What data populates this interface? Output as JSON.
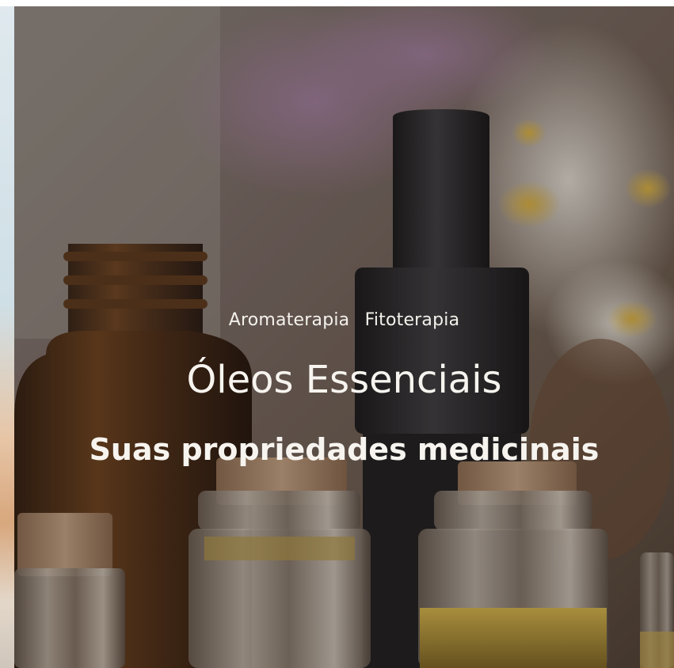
{
  "hero": {
    "tags": [
      "Aromaterapia",
      "Fitoterapia"
    ],
    "title": "Óleos Essenciais",
    "subtitle": "Suas propriedades medicinais"
  },
  "colors": {
    "caption_text": "#f7f4ef",
    "overlay": "#28221e",
    "amber_glass": "#5a3517",
    "cork": "#b08a6a",
    "dropper_cap": "#1f1f22"
  },
  "icons": {
    "background_image": "essential-oil-bottles-photo"
  }
}
